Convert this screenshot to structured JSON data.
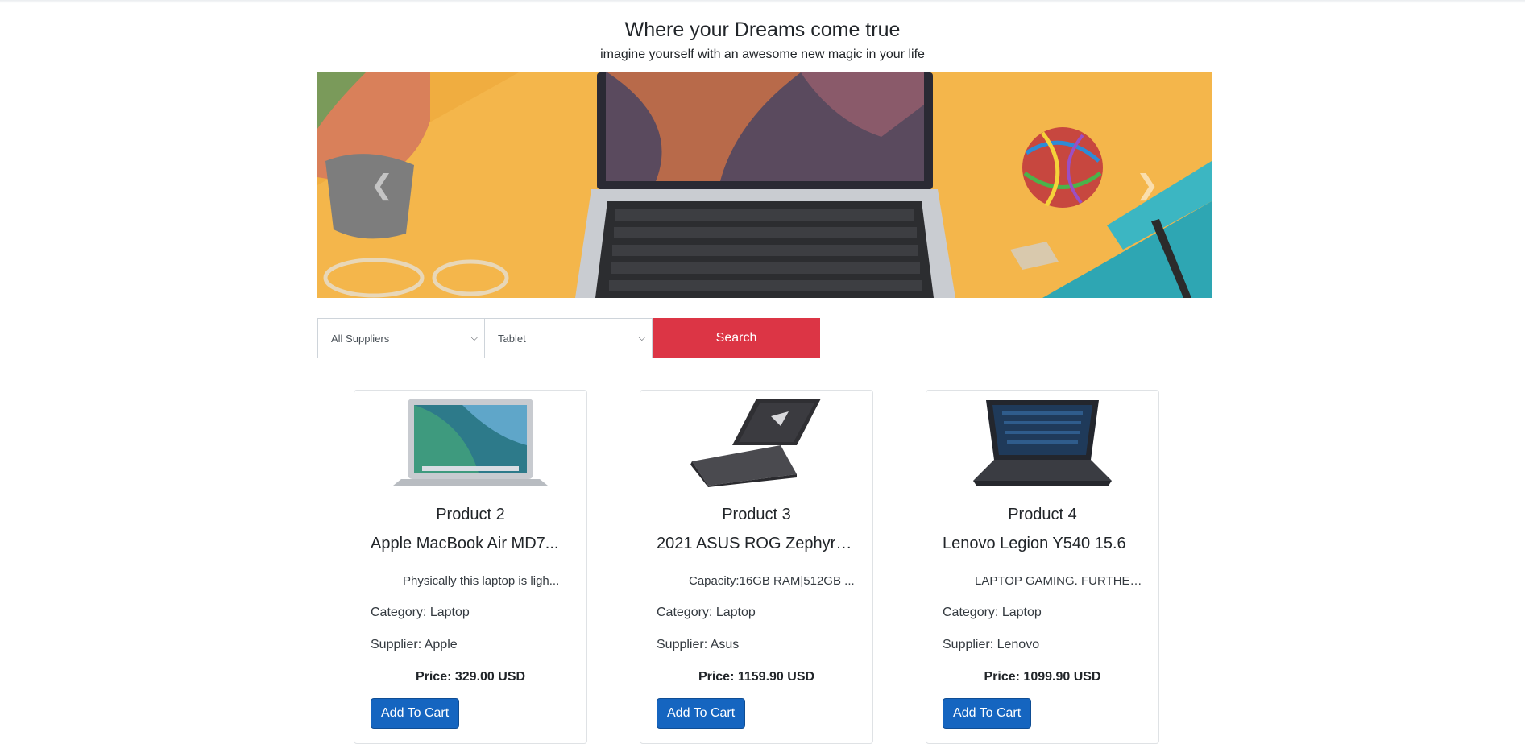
{
  "header": {
    "title": "Where your Dreams come true",
    "subtitle": "imagine yourself with an awesome new magic in your life"
  },
  "carousel": {
    "prev_icon": "chevron-left-icon",
    "next_icon": "chevron-right-icon"
  },
  "search": {
    "supplier_selected": "All Suppliers",
    "category_selected": "Tablet",
    "button_label": "Search",
    "button_color": "#dc3545"
  },
  "products": [
    {
      "number": "Product 2",
      "name": "Apple MacBook Air MD7...",
      "description": "Physically this laptop is ligh...",
      "category_label": "Category:",
      "category": "Laptop",
      "supplier_label": "Supplier:",
      "supplier": "Apple",
      "price_label": "Price:",
      "price": "329.00 USD",
      "cart_label": "Add To Cart"
    },
    {
      "number": "Product 3",
      "name": "2021 ASUS ROG Zephyru...",
      "description": "Capacity:16GB RAM|512GB ...",
      "category_label": "Category:",
      "category": "Laptop",
      "supplier_label": "Supplier:",
      "supplier": "Asus",
      "price_label": "Price:",
      "price": "1159.90 USD",
      "cart_label": "Add To Cart"
    },
    {
      "number": "Product 4",
      "name": "Lenovo Legion Y540 15.6",
      "description": "LAPTOP GAMING. FURTHER...",
      "category_label": "Category:",
      "category": "Laptop",
      "supplier_label": "Supplier:",
      "supplier": "Lenovo",
      "price_label": "Price:",
      "price": "1099.90 USD",
      "cart_label": "Add To Cart"
    }
  ],
  "colors": {
    "cart_button": "#1565c0",
    "carousel_bg": "#f4b64b"
  }
}
